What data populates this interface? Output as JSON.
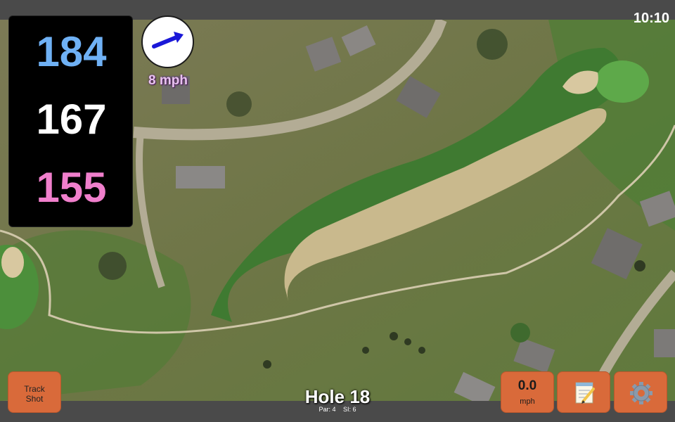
{
  "status_bar": {
    "time": "10:10"
  },
  "distances": {
    "back": "184",
    "middle": "167",
    "front": "155"
  },
  "wind": {
    "speed": "8 mph",
    "direction": "east-northeast",
    "arrow_color": "#1a18d8"
  },
  "track_shot": {
    "label": "Track\nShot"
  },
  "shot_speed": {
    "value": "0.0",
    "unit": "mph"
  },
  "notes": {
    "icon": "notepad-icon"
  },
  "settings": {
    "icon": "gear-icon"
  },
  "hole": {
    "title": "Hole 18",
    "par": "Par: 4",
    "si": "SI: 6"
  },
  "colors": {
    "button": "#d96a3a",
    "back_distance": "#6fb1f5",
    "middle_distance": "#ffffff",
    "front_distance": "#f07fcc",
    "wind_label": "#e8c2f0"
  }
}
